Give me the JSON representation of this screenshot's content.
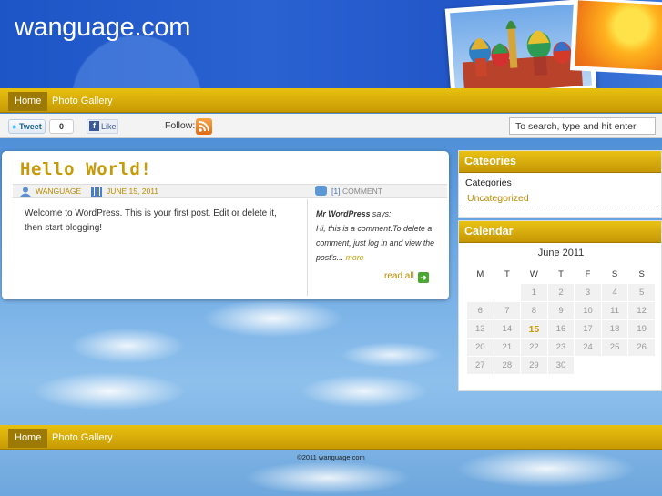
{
  "header": {
    "site_title": "wanguage.com"
  },
  "nav": {
    "items": [
      {
        "label": "Home"
      },
      {
        "label": "Photo Gallery"
      }
    ]
  },
  "social": {
    "tweet_label": "Tweet",
    "tweet_count": "0",
    "like_label": "Like",
    "follow_label": "Follow:"
  },
  "search": {
    "placeholder": "To search, type and hit enter"
  },
  "post": {
    "title": "Hello World!",
    "author": "WANGUAGE",
    "date": "JUNE 15, 2011",
    "comment_count": "[1]",
    "comment_label": "COMMENT",
    "body": "Welcome to WordPress. This is your first post. Edit or delete it, then start blogging!",
    "comment": {
      "author": "Mr WordPress",
      "says": " says:",
      "text": "Hi, this is a comment.To delete a comment, just log in and view the post's...",
      "more": "more"
    },
    "read_all": "read all"
  },
  "sidebar": {
    "categories": {
      "heading": "Cateories",
      "label": "Categories",
      "items": [
        "Uncategorized"
      ]
    },
    "calendar": {
      "heading": "Calendar",
      "month": "June 2011",
      "weekdays": [
        "M",
        "T",
        "W",
        "T",
        "F",
        "S",
        "S"
      ],
      "weeks": [
        [
          "",
          "",
          "1",
          "2",
          "3",
          "4",
          "5"
        ],
        [
          "6",
          "7",
          "8",
          "9",
          "10",
          "11",
          "12"
        ],
        [
          "13",
          "14",
          "15",
          "16",
          "17",
          "18",
          "19"
        ],
        [
          "20",
          "21",
          "22",
          "23",
          "24",
          "25",
          "26"
        ],
        [
          "27",
          "28",
          "29",
          "30",
          "",
          "",
          ""
        ]
      ],
      "today": "15"
    }
  },
  "footer": {
    "copyright": "©2011 wanguage.com"
  }
}
